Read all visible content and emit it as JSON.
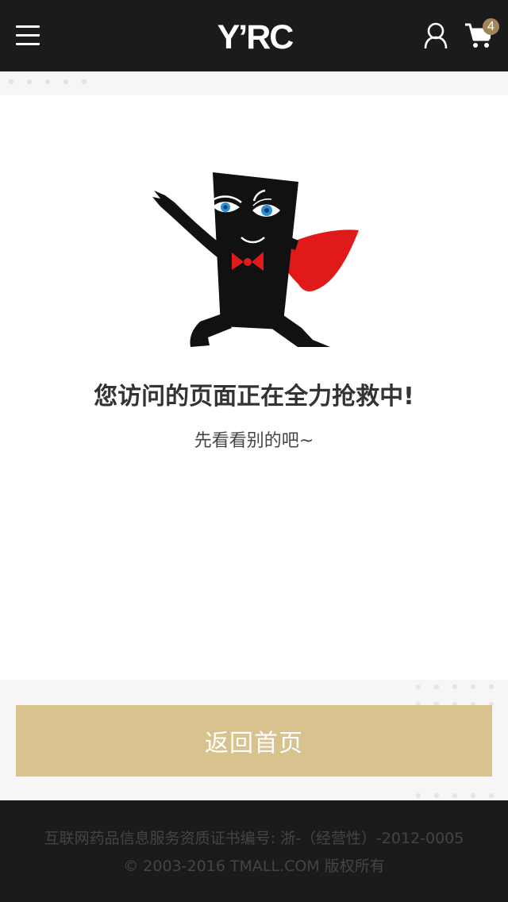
{
  "header": {
    "menu_icon": "hamburger-menu-icon",
    "logo_text": "Y’RC",
    "user_icon": "user-icon",
    "cart_icon": "shopping-cart-icon",
    "cart_count": "4"
  },
  "main": {
    "title": "您访问的页面正在全力抢救中!",
    "subtitle": "先看看别的吧~",
    "illustration": "superhero-mascot-illustration"
  },
  "actions": {
    "home_button_label": "返回首页"
  },
  "footer": {
    "license": "互联网药品信息服务资质证书编号: 浙-（经营性）-2012-0005",
    "copyright": "© 2003-2016 TMALL.COM 版权所有"
  },
  "colors": {
    "header_bg": "#1b1b1b",
    "button_bg": "#d8c28e",
    "badge_bg": "#a2865a",
    "accent_red": "#e01a1a",
    "eye_blue": "#2b8fd6"
  }
}
